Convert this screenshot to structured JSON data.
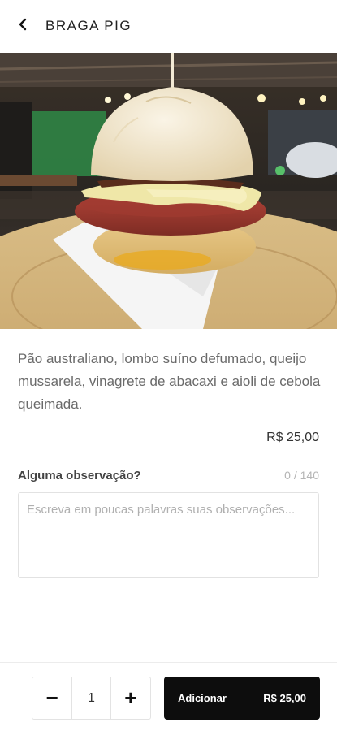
{
  "header": {
    "title": "BRAGA PIG",
    "back_icon": "chevron-left-icon"
  },
  "product": {
    "description": "Pão australiano, lombo suíno defumado, queijo mussarela, vinagrete de abacaxi e aioli de cebola queimada.",
    "price": "R$ 25,00"
  },
  "observation": {
    "label": "Alguma observação?",
    "counter": "0 / 140",
    "placeholder": "Escreva em poucas palavras suas observações..."
  },
  "footer": {
    "minus_label": "−",
    "quantity": "1",
    "plus_label": "+",
    "add_label": "Adicionar",
    "add_price": "R$ 25,00"
  }
}
